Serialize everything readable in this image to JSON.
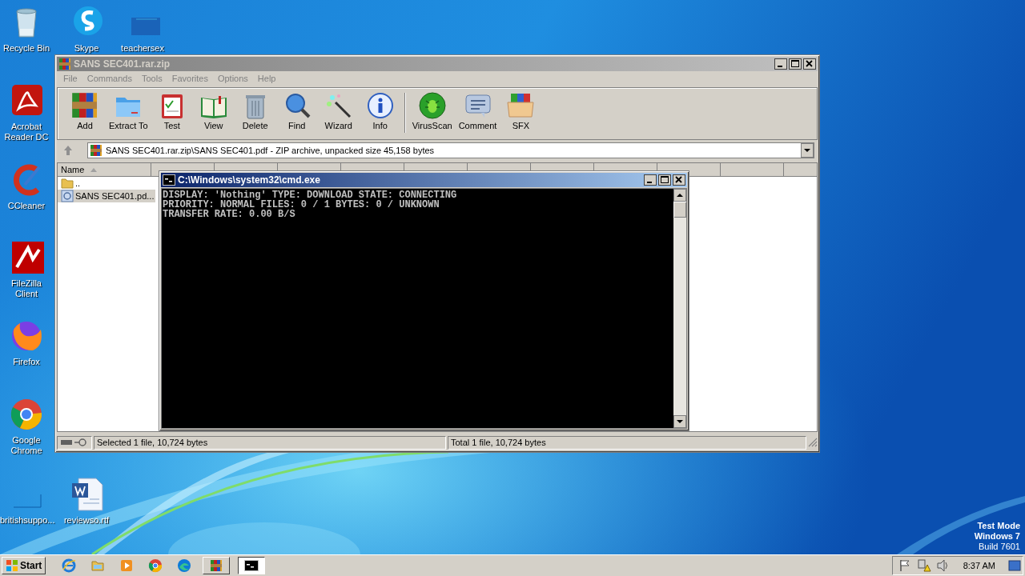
{
  "desktop_icons": [
    {
      "label": "Recycle Bin"
    },
    {
      "label": "Acrobat Reader DC"
    },
    {
      "label": "CCleaner"
    },
    {
      "label": "FileZilla Client"
    },
    {
      "label": "Firefox"
    },
    {
      "label": "Google Chrome"
    },
    {
      "label": "britishsuppo..."
    },
    {
      "label": "Skype"
    },
    {
      "label": "teachersex"
    },
    {
      "label": "reviewso.rtf"
    }
  ],
  "archive_window": {
    "title": "SANS SEC401.rar.zip",
    "active": false,
    "menu": [
      "File",
      "Commands",
      "Tools",
      "Favorites",
      "Options",
      "Help"
    ],
    "toolbar": [
      "Add",
      "Extract To",
      "Test",
      "View",
      "Delete",
      "Find",
      "Wizard",
      "Info",
      "VirusScan",
      "Comment",
      "SFX"
    ],
    "address": "SANS SEC401.rar.zip\\SANS SEC401.pdf  - ZIP archive, unpacked size 45,158 bytes",
    "columns": [
      "Name"
    ],
    "files": [
      {
        "name": "..",
        "selected": false
      },
      {
        "name": "SANS SEC401.pd...",
        "selected": true
      }
    ],
    "status_left": "Selected 1 file, 10,724 bytes",
    "status_right": "Total 1 file, 10,724 bytes"
  },
  "console_window": {
    "title": "C:\\Windows\\system32\\cmd.exe",
    "active": true,
    "lines": [
      "DISPLAY: 'Nothing' TYPE: DOWNLOAD STATE: CONNECTING",
      "PRIORITY: NORMAL FILES: 0 / 1 BYTES: 0 / UNKNOWN",
      "TRANSFER RATE: 0.00 B/S"
    ]
  },
  "taskbar": {
    "start": "Start",
    "tasks": [
      {
        "selected": false
      },
      {
        "selected": true
      }
    ],
    "clock": "8:37 AM"
  },
  "os_notice": [
    "Test Mode",
    "Windows 7",
    "Build 7601"
  ]
}
